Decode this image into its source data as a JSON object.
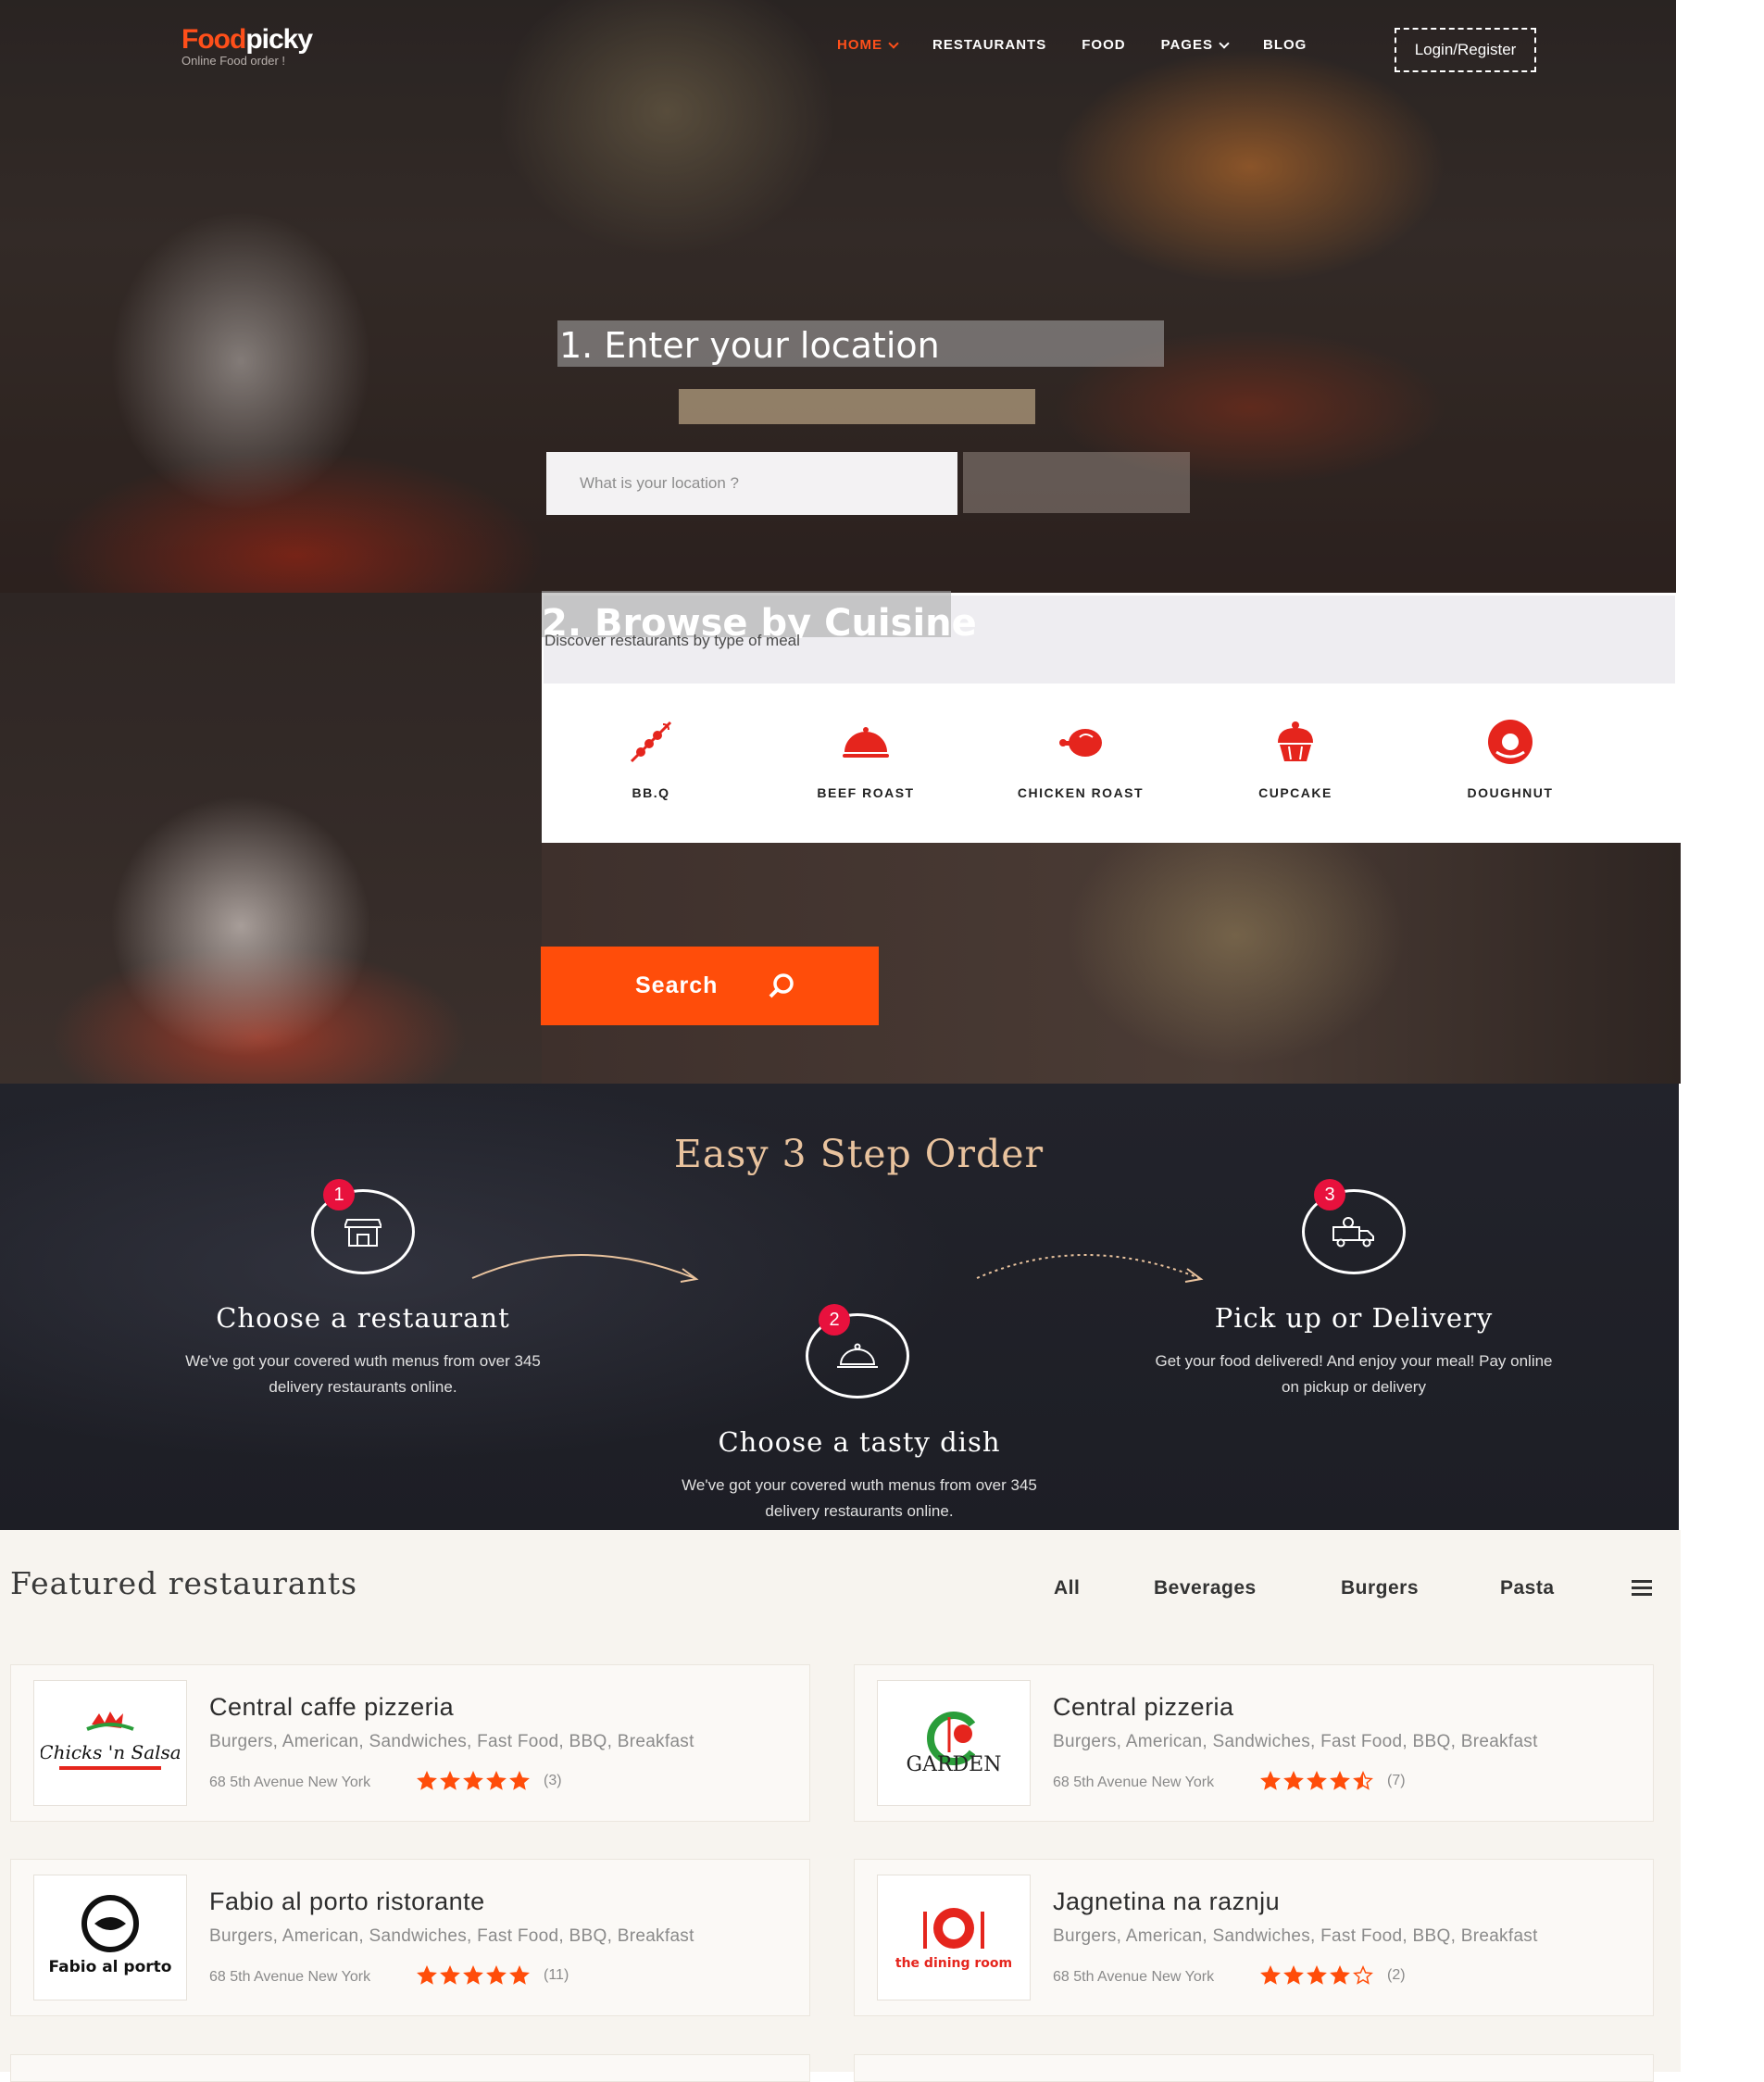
{
  "header": {
    "logo_main_accent": "Food",
    "logo_main_rest": "picky",
    "logo_sub": "Online Food order !",
    "nav": [
      {
        "label": "HOME",
        "has_dropdown": true,
        "active": true
      },
      {
        "label": "RESTAURANTS",
        "has_dropdown": false,
        "active": false
      },
      {
        "label": "FOOD",
        "has_dropdown": false,
        "active": false
      },
      {
        "label": "PAGES",
        "has_dropdown": true,
        "active": false
      },
      {
        "label": "BLOG",
        "has_dropdown": false,
        "active": false
      }
    ],
    "login_label": "Login/Register"
  },
  "hero": {
    "step1_title": "1. Enter your location",
    "location_placeholder": "What is your location ?"
  },
  "cuisine": {
    "title": "2. Browse by Cuisine",
    "subtitle": "Discover restaurants by type of meal",
    "items": [
      {
        "label": "BB.Q",
        "icon": "bbq-skewer-icon"
      },
      {
        "label": "BEEF ROAST",
        "icon": "food-cloche-icon"
      },
      {
        "label": "CHICKEN ROAST",
        "icon": "roast-chicken-icon"
      },
      {
        "label": "CUPCAKE",
        "icon": "cupcake-icon"
      },
      {
        "label": "DOUGHNUT",
        "icon": "doughnut-icon"
      }
    ],
    "search_label": "Search"
  },
  "steps": {
    "title": "Easy 3 Step Order",
    "items": [
      {
        "number": "1",
        "title": "Choose a restaurant",
        "desc_line1": "We've got your covered wuth menus from over 345",
        "desc_line2": "delivery restaurants online.",
        "icon": "shop-icon"
      },
      {
        "number": "2",
        "title": "Choose a tasty dish",
        "desc_line1": "We've got your covered wuth menus from over 345",
        "desc_line2": "delivery restaurants online.",
        "icon": "cloche-icon"
      },
      {
        "number": "3",
        "title": "Pick up or Delivery",
        "desc_line1": "Get your food delivered! And enjoy your meal! Pay online",
        "desc_line2": "on pickup or delivery",
        "icon": "delivery-truck-icon"
      }
    ]
  },
  "featured": {
    "title": "Featured restaurants",
    "filters": [
      "All",
      "Beverages",
      "Burgers",
      "Pasta"
    ],
    "restaurants": [
      {
        "name": "Central caffe pizzeria",
        "tags": "Burgers, American, Sandwiches, Fast Food, BBQ, Breakfast",
        "address": "68 5th Avenue New York",
        "rating": 5,
        "count": "(3)",
        "logo_text": "Chicks 'n Salsa"
      },
      {
        "name": "Central pizzeria",
        "tags": "Burgers, American, Sandwiches, Fast Food, BBQ, Breakfast",
        "address": "68 5th Avenue New York",
        "rating": 4.5,
        "count": "(7)",
        "logo_text": "GARDEN"
      },
      {
        "name": "Fabio al porto ristorante",
        "tags": "Burgers, American, Sandwiches, Fast Food, BBQ, Breakfast",
        "address": "68 5th Avenue New York",
        "rating": 5,
        "count": "(11)",
        "logo_text": "Fabio al porto"
      },
      {
        "name": "Jagnetina na raznju",
        "tags": "Burgers, American, Sandwiches, Fast Food, BBQ, Breakfast",
        "address": "68 5th Avenue New York",
        "rating": 4,
        "count": "(2)",
        "logo_text": "the dining room"
      }
    ]
  },
  "colors": {
    "accent": "#ff4d0a",
    "icon_red": "#e5251d",
    "badge": "#e8113d",
    "steps_title": "#e9c39e"
  }
}
